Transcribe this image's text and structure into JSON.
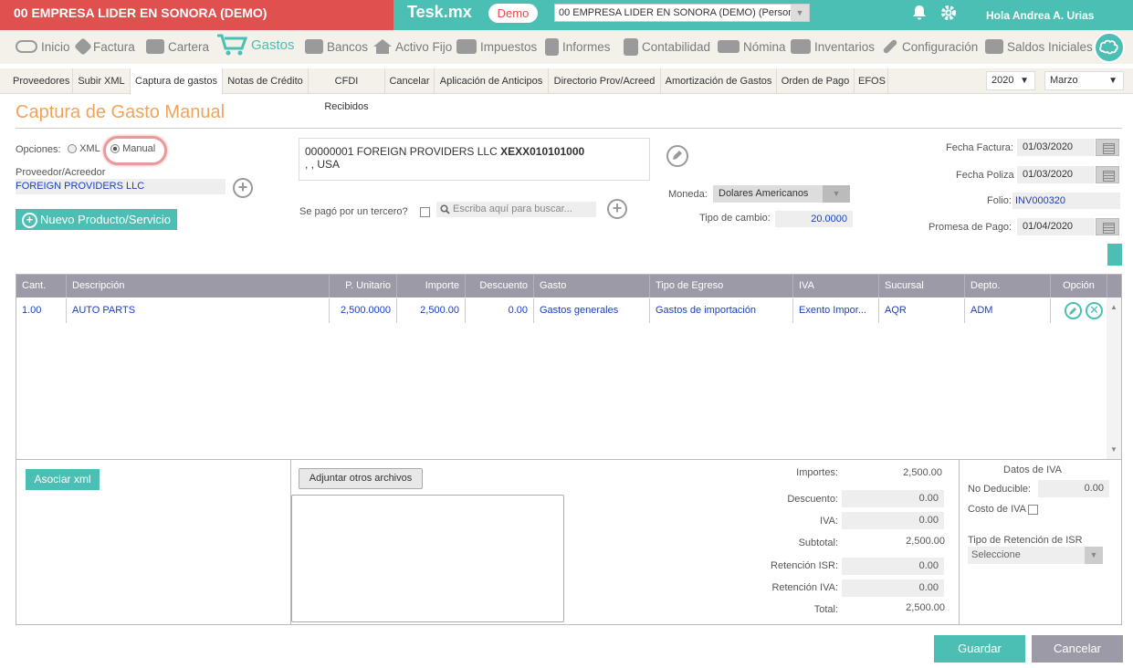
{
  "top": {
    "company": "00 EMPRESA LIDER EN SONORA (DEMO)",
    "brand": "Tesk.mx",
    "demo_badge": "Demo",
    "company_select": "00 EMPRESA LIDER EN SONORA (DEMO) (Persona",
    "greeting": "Hola Andrea A. Urias"
  },
  "nav": [
    "Inicio",
    "Factura",
    "Cartera",
    "Gastos",
    "Bancos",
    "Activo Fijo",
    "Impuestos",
    "Informes",
    "Contabilidad",
    "Nómina",
    "Inventarios",
    "Configuración",
    "Saldos Iniciales"
  ],
  "subnav": [
    "Proveedores",
    "Subir XML",
    "Captura de gastos",
    "Notas de Crédito",
    "CFDI Recibidos",
    "Cancelar",
    "Aplicación de Anticipos",
    "Directorio Prov/Acreed",
    "Amortización de Gastos",
    "Orden de Pago",
    "EFOS"
  ],
  "year": "2020",
  "month": "Marzo",
  "page_title": "Captura de Gasto Manual",
  "form": {
    "opciones_label": "Opciones:",
    "opt_xml": "XML",
    "opt_manual": "Manual",
    "proveedor_label": "Proveedor/Acreedor",
    "proveedor_value": "FOREIGN PROVIDERS LLC",
    "nuevo_btn": "Nuevo Producto/Servicio",
    "supplier_line1": "00000001 FOREIGN PROVIDERS LLC",
    "supplier_rfc": "XEXX010101000",
    "supplier_line2": ", , USA",
    "tercero_label": "Se pagó por un tercero?",
    "search_placeholder": "Escriba aquí para buscar...",
    "moneda_label": "Moneda:",
    "moneda_value": "Dolares Americanos",
    "tipo_cambio_label": "Tipo de cambio:",
    "tipo_cambio_value": "20.0000",
    "fecha_factura_label": "Fecha Factura:",
    "fecha_factura": "01/03/2020",
    "fecha_poliza_label": "Fecha Poliza",
    "fecha_poliza": "01/03/2020",
    "folio_label": "Folio:",
    "folio": "INV000320",
    "promesa_label": "Promesa de Pago:",
    "promesa": "01/04/2020"
  },
  "table": {
    "headers": [
      "Cant.",
      "Descripción",
      "P. Unitario",
      "Importe",
      "Descuento",
      "Gasto",
      "Tipo de Egreso",
      "IVA",
      "Sucursal",
      "Depto.",
      "Opción"
    ],
    "row": [
      "1.00",
      "AUTO PARTS",
      "2,500.0000",
      "2,500.00",
      "0.00",
      "Gastos generales",
      "Gastos de importación",
      "Exento Impor...",
      "AQR",
      "ADM"
    ]
  },
  "bottom": {
    "asociar_btn": "Asociar xml",
    "adjuntar_btn": "Adjuntar otros archivos",
    "importes_label": "Importes:",
    "importes": "2,500.00",
    "descuento_label": "Descuento:",
    "descuento": "0.00",
    "iva_label": "IVA:",
    "iva": "0.00",
    "subtotal_label": "Subtotal:",
    "subtotal": "2,500.00",
    "ret_isr_label": "Retención ISR:",
    "ret_isr": "0.00",
    "ret_iva_label": "Retención IVA:",
    "ret_iva": "0.00",
    "total_label": "Total:",
    "total": "2,500.00",
    "datos_iva": "Datos de IVA",
    "no_deducible_label": "No Deducible:",
    "no_deducible": "0.00",
    "costo_iva_label": "Costo de IVA",
    "tipo_ret_label": "Tipo de Retención de ISR",
    "tipo_ret_value": "Seleccione"
  },
  "actions": {
    "guardar": "Guardar",
    "cancelar": "Cancelar"
  },
  "colors": {
    "teal": "#4bbfb3",
    "red": "#e0504f",
    "orange": "#f0a45a",
    "link": "#1a3fbf"
  }
}
